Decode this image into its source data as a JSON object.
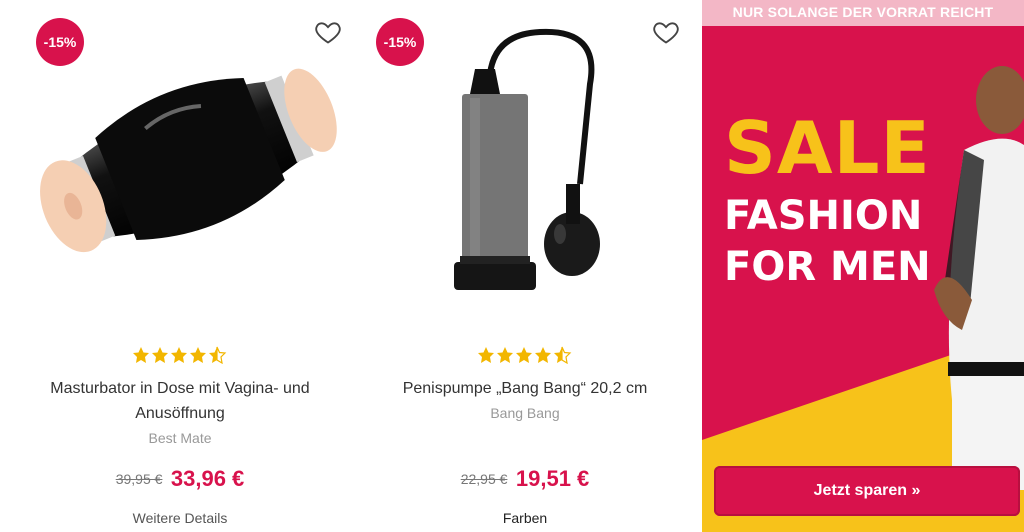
{
  "products": [
    {
      "badge": "-15%",
      "title": "Masturbator in Dose mit Vagina- und Anusöffnung",
      "brand": "Best Mate",
      "old_price": "39,95 €",
      "new_price": "33,96 €",
      "details_label": "Weitere Details",
      "rating": 4.5
    },
    {
      "badge": "-15%",
      "title": "Penispumpe „Bang Bang“ 20,2 cm",
      "brand": "Bang Bang",
      "old_price": "22,95 €",
      "new_price": "19,51 €",
      "details_label": "Farben",
      "rating": 4.5
    }
  ],
  "banner": {
    "top_text": "NUR SOLANGE DER VORRAT REICHT",
    "line1": "SALE",
    "line2": "FASHION",
    "line3": "FOR MEN",
    "cta_label": "Jetzt sparen »"
  },
  "colors": {
    "accent": "#d8124c",
    "star": "#f2b600",
    "sale_yellow": "#f7c21a"
  }
}
